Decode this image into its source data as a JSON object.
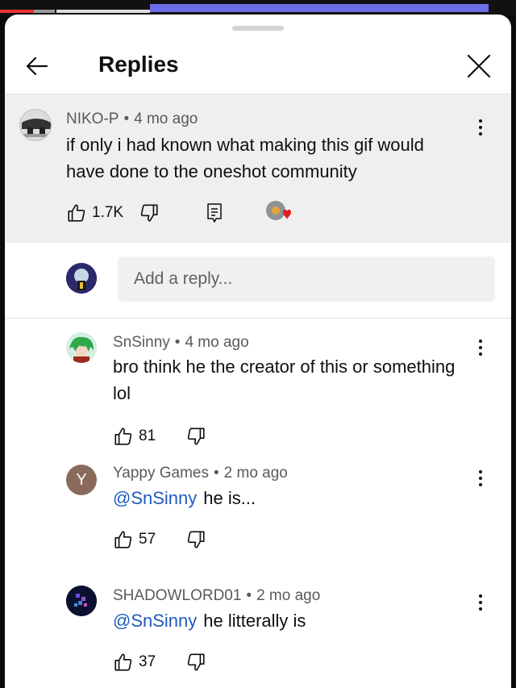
{
  "header": {
    "title": "Replies"
  },
  "parent_comment": {
    "author": "NIKO-P",
    "time": "4 mo ago",
    "text": "if only i had known what making this gif would have done to the oneshot community",
    "likes": "1.7K"
  },
  "reply_box": {
    "placeholder": "Add a reply..."
  },
  "replies": [
    {
      "author": "SnSinny",
      "time": "4 mo ago",
      "text": "bro think he the creator of this or something lol",
      "likes": "81"
    },
    {
      "author": "Yappy Games",
      "time": "2 mo ago",
      "avatar_letter": "Y",
      "mention": "@SnSinny",
      "text": "he is...",
      "likes": "57"
    },
    {
      "author": "SHADOWLORD01",
      "time": "2 mo ago",
      "mention": "@SnSinny",
      "text": "he litterally is",
      "likes": "37"
    }
  ],
  "icons": {
    "back": "arrow-left-icon",
    "close": "close-icon",
    "like": "thumbs-up-icon",
    "dislike": "thumbs-down-icon",
    "reply": "comment-icon",
    "more": "more-vert-icon",
    "creator_heart": "creator-heart-icon"
  },
  "colors": {
    "mention": "#1f5bbd",
    "heart": "#e01e1e",
    "parent_bg": "#efefef",
    "yappy_avatar": "#8a6a5a"
  }
}
